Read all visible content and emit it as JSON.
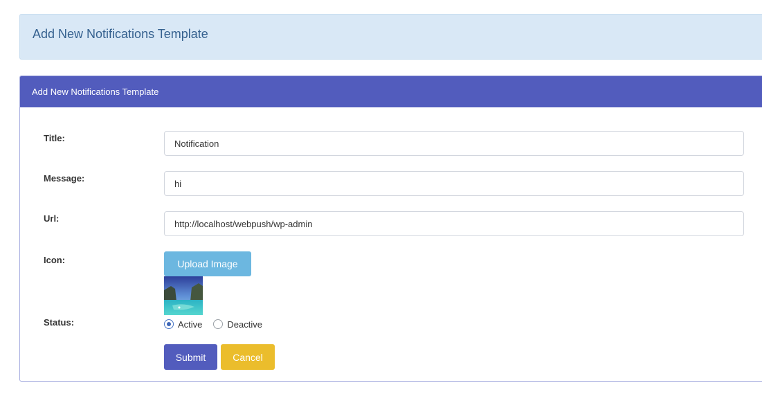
{
  "page_header": {
    "title": "Add New Notifications Template"
  },
  "panel": {
    "heading": "Add New Notifications Template"
  },
  "form": {
    "title": {
      "label": "Title:",
      "value": "Notification"
    },
    "message": {
      "label": "Message:",
      "value": "hi"
    },
    "url": {
      "label": "Url:",
      "value": "http://localhost/webpush/wp-admin"
    },
    "icon": {
      "label": "Icon:",
      "upload_label": "Upload Image",
      "preview_icon": "landscape-thumbnail"
    },
    "status": {
      "label": "Status:",
      "options": [
        {
          "label": "Active",
          "checked": true
        },
        {
          "label": "Deactive",
          "checked": false
        }
      ]
    },
    "submit_label": "Submit",
    "cancel_label": "Cancel"
  },
  "colors": {
    "header_bg": "#d9e8f6",
    "header_text": "#35618f",
    "panel_heading_bg": "#525cbd",
    "upload_button": "#6cb7e0",
    "submit_button": "#525cbd",
    "cancel_button": "#ebbd2c"
  }
}
